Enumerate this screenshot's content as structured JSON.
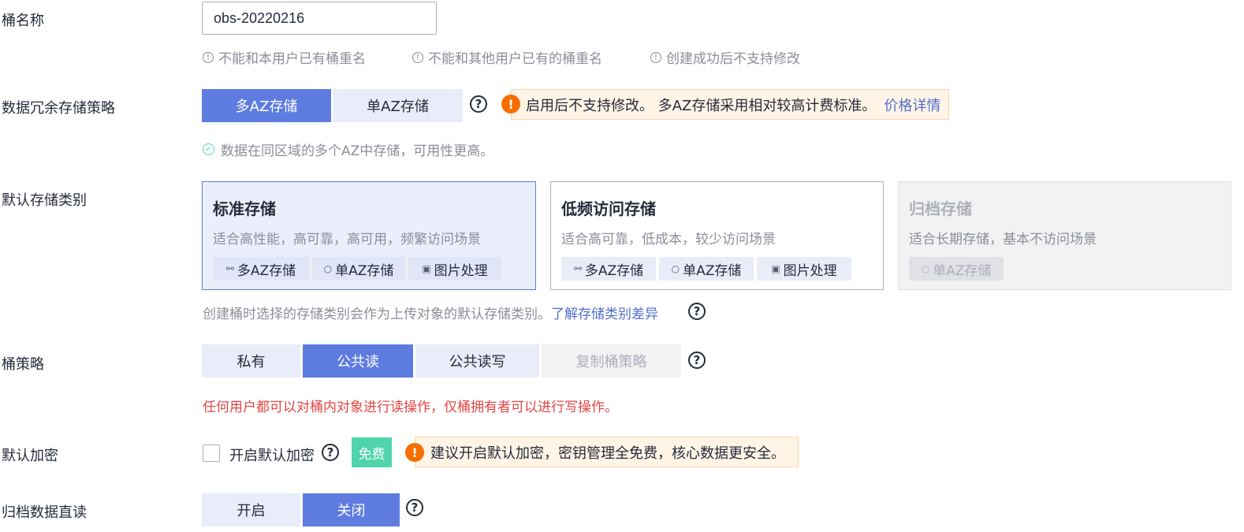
{
  "bucket_name": {
    "label": "桶名称",
    "value": "obs-20220216",
    "hints": [
      "不能和本用户已有桶重名",
      "不能和其他用户已有的桶重名",
      "创建成功后不支持修改"
    ]
  },
  "redundancy": {
    "label": "数据冗余存储策略",
    "options": [
      "多AZ存储",
      "单AZ存储"
    ],
    "selected": "多AZ存储",
    "warning_text": "启用后不支持修改。 多AZ存储采用相对较高计费标准。",
    "warning_link": "价格详情",
    "success_hint": "数据在同区域的多个AZ中存储，可用性更高。"
  },
  "storage_class": {
    "label": "默认存储类别",
    "cards": [
      {
        "title": "标准存储",
        "desc": "适合高性能，高可靠，高可用，频繁访问场景",
        "tags": [
          "多AZ存储",
          "单AZ存储",
          "图片处理"
        ],
        "state": "selected"
      },
      {
        "title": "低频访问存储",
        "desc": "适合高可靠，低成本，较少访问场景",
        "tags": [
          "多AZ存储",
          "单AZ存储",
          "图片处理"
        ],
        "state": "normal"
      },
      {
        "title": "归档存储",
        "desc": "适合长期存储，基本不访问场景",
        "tags": [
          "单AZ存储"
        ],
        "state": "disabled"
      }
    ],
    "hint_text": "创建桶时选择的存储类别会作为上传对象的默认存储类别。",
    "hint_link": "了解存储类别差异"
  },
  "bucket_policy": {
    "label": "桶策略",
    "options": [
      "私有",
      "公共读",
      "公共读写",
      "复制桶策略"
    ],
    "selected": "公共读",
    "warning": "任何用户都可以对桶内对象进行读操作，仅桶拥有者可以进行写操作。"
  },
  "encryption": {
    "label": "默认加密",
    "checkbox_label": "开启默认加密",
    "checked": false,
    "badge": "免费",
    "tip": "建议开启默认加密，密钥管理全免费，核心数据更安全。"
  },
  "archive_direct_read": {
    "label": "归档数据直读",
    "options": [
      "开启",
      "关闭"
    ],
    "selected": "关闭"
  },
  "icons": {
    "info": "!",
    "help": "?",
    "warning": "!",
    "check": "✓"
  },
  "colors": {
    "primary": "#5e7ce0",
    "warning_orange": "#f66f00",
    "danger_red": "#e54545",
    "success_green": "#50d4ab",
    "link": "#526ecc"
  }
}
